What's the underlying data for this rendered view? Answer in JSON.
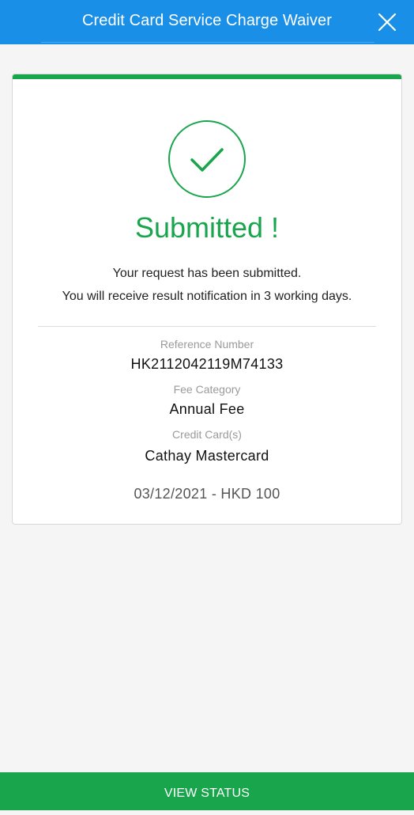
{
  "header": {
    "title": "Credit Card Service Charge Waiver",
    "close_icon": "close-icon"
  },
  "result": {
    "icon": "check-circle-icon",
    "status": "Submitted !",
    "message_line1": "Your request has been submitted.",
    "message_line2": "You will receive result notification in 3 working days."
  },
  "details": {
    "reference_label": "Reference Number",
    "reference_value": "HK2112042119M74133",
    "fee_label": "Fee Category",
    "fee_value": "Annual Fee",
    "card_label": "Credit Card(s)",
    "card_value": "Cathay Mastercard",
    "transaction": "03/12/2021 - HKD 100"
  },
  "footer": {
    "button_label": "VIEW STATUS"
  },
  "colors": {
    "header_bg": "#1a8fe8",
    "success_green": "#18a54c",
    "page_bg": "#f5f5f5"
  }
}
